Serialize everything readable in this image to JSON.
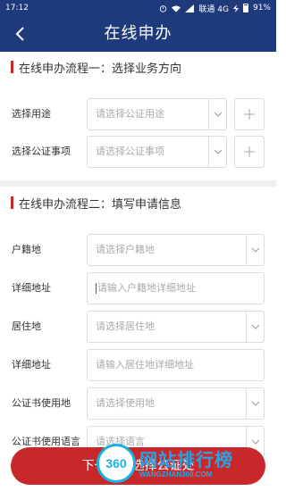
{
  "status_bar": {
    "time": "17:12",
    "carrier": "联通 4G",
    "battery": "91%"
  },
  "nav": {
    "title": "在线申办"
  },
  "section1": {
    "title": "在线申办流程一：选择业务方向",
    "rows": [
      {
        "label": "选择用途",
        "placeholder": "请选择公证用途"
      },
      {
        "label": "选择公证事项",
        "placeholder": "请选择公证事项"
      }
    ]
  },
  "section2": {
    "title": "在线申办流程二：填写申请信息",
    "rows": [
      {
        "label": "户籍地",
        "placeholder": "请选择户籍地"
      },
      {
        "label": "详细地址",
        "placeholder": "请输入户籍地详细地址"
      },
      {
        "label": "居住地",
        "placeholder": "请选择居住地"
      },
      {
        "label": "详细地址",
        "placeholder": "请输入居住地详细地址"
      },
      {
        "label": "公证书使用地",
        "placeholder": "请选择使用地"
      },
      {
        "label": "公证书使用语言",
        "placeholder": "请选择语言"
      }
    ]
  },
  "footer": {
    "submit_label": "下一步，选择公证处"
  },
  "watermark": {
    "badge": "360",
    "title": "网站排行榜",
    "domain": "WANGZHAN360.COM"
  }
}
